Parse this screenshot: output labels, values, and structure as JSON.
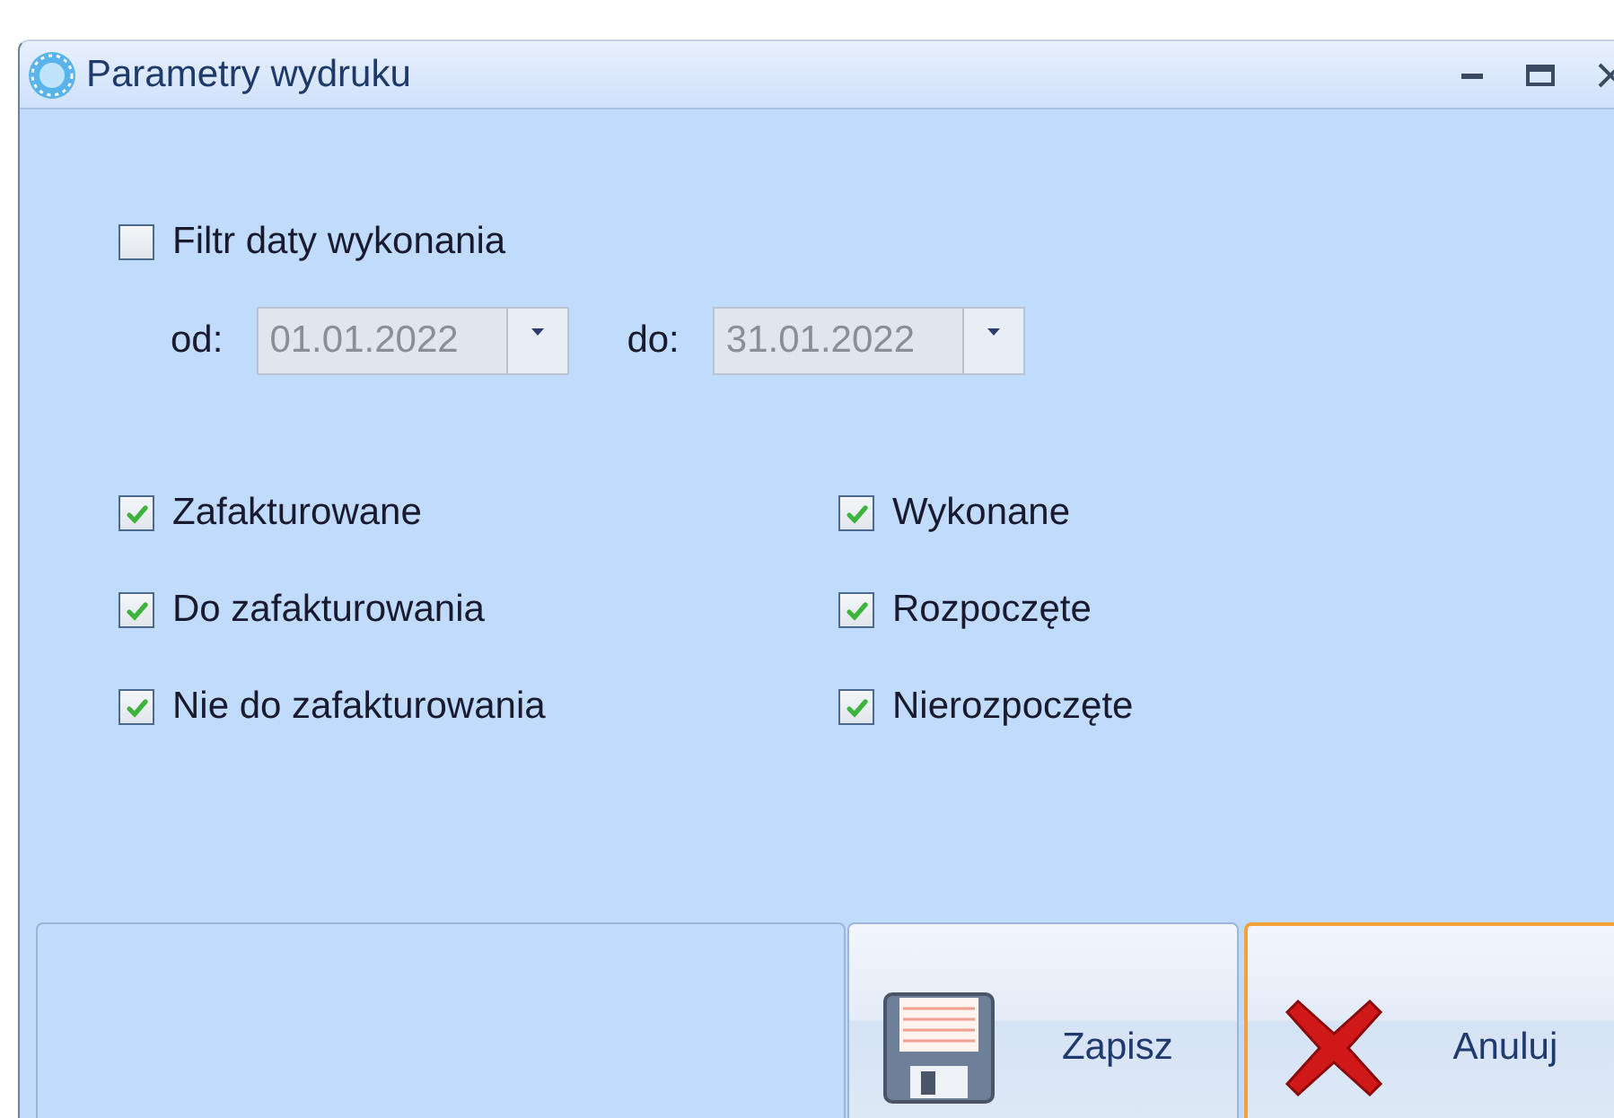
{
  "window": {
    "title": "Parametry wydruku"
  },
  "date_filter": {
    "label": "Filtr daty wykonania",
    "checked": false,
    "disabled": true,
    "from_label": "od:",
    "from": "01.01.2022",
    "to_label": "do:",
    "to": "31.01.2022"
  },
  "checkboxes": [
    {
      "label": "Zafakturowane",
      "checked": true
    },
    {
      "label": "Wykonane",
      "checked": true
    },
    {
      "label": "Do zafakturowania",
      "checked": true
    },
    {
      "label": "Rozpoczęte",
      "checked": true
    },
    {
      "label": "Nie do zafakturowania",
      "checked": true
    },
    {
      "label": "Nierozpoczęte",
      "checked": true
    }
  ],
  "buttons": [
    {
      "kind": "save",
      "label": "Zapisz",
      "focused": false
    },
    {
      "kind": "cancel",
      "label": "Anuluj",
      "focused": true
    }
  ]
}
